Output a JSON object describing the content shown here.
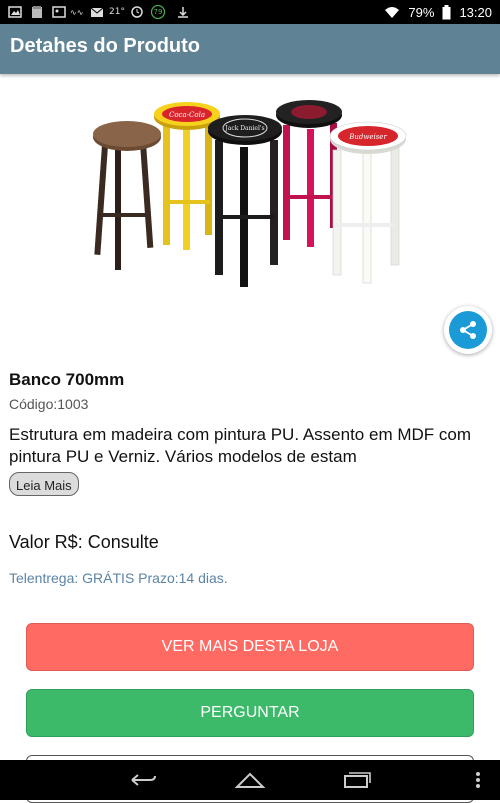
{
  "status_bar": {
    "temperature": "21°",
    "badge": "79",
    "battery": "79%",
    "time": "13:20"
  },
  "app_bar": {
    "title": "Detahes do Produto"
  },
  "product": {
    "name": "Banco 700mm",
    "code": "Código:1003",
    "description": "Estrutura em madeira com pintura PU. Assento em MDF com pintura PU e Verniz. Vários modelos de estam",
    "read_more": "Leia Mais",
    "price": "Valor R$: Consulte",
    "delivery": "Telentrega: GRÁTIS Prazo:14 dias.",
    "image_seat_texts": [
      "Coca-Cola",
      "Jack Daniel's",
      "Budweiser"
    ]
  },
  "buttons": {
    "more_from_store": "VER MAIS DESTA LOJA",
    "ask": "PERGUNTAR"
  },
  "colors": {
    "app_bar": "#5f8294",
    "button_red": "#ff6b63",
    "button_green": "#3cba6a",
    "share": "#1a9bd7",
    "delivery_text": "#5b84a6"
  },
  "icons": {
    "share": "share-icon",
    "nav_back": "back-icon",
    "nav_home": "home-icon",
    "nav_recent": "recent-apps-icon",
    "nav_menu": "overflow-menu-icon"
  }
}
